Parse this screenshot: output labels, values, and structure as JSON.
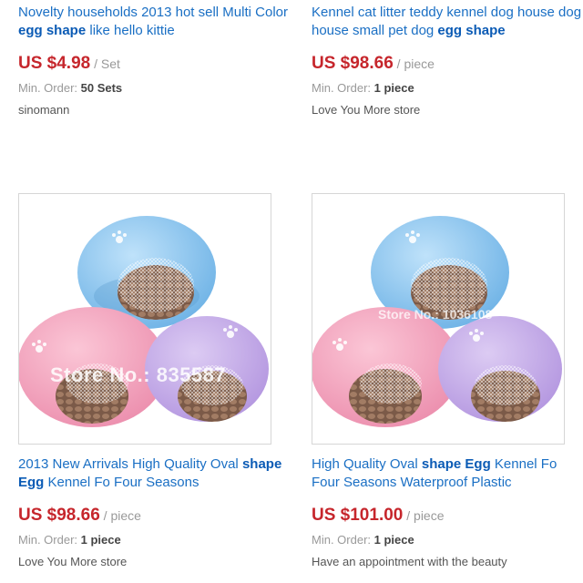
{
  "products": [
    {
      "title_parts": [
        "Novelty households 2013 hot sell Multi Color ",
        "egg shape",
        " like hello kittie"
      ],
      "price": "US $4.98",
      "unit": " / Set",
      "min_order_label": "Min. Order: ",
      "min_order_value": "50 Sets",
      "store": "sinomann"
    },
    {
      "title_parts": [
        "Kennel cat litter teddy kennel dog house dog house small pet dog ",
        "egg shape",
        ""
      ],
      "price": "US $98.66",
      "unit": " / piece",
      "min_order_label": "Min. Order: ",
      "min_order_value": "1 piece",
      "store": "Love You More store"
    },
    {
      "image_watermark": "Store No.: 835587",
      "title_parts": [
        "2013 New Arrivals High Quality Oval ",
        "shape Egg",
        " Kennel Fo Four Seasons"
      ],
      "price": "US $98.66",
      "unit": " / piece",
      "min_order_label": "Min. Order: ",
      "min_order_value": "1 piece",
      "store": "Love You More store"
    },
    {
      "image_watermark": "Store No.: 1036108",
      "title_parts": [
        "High Quality Oval ",
        "shape Egg",
        " Kennel Fo Four Seasons Waterproof Plastic"
      ],
      "price": "US $101.00",
      "unit": " / piece",
      "min_order_label": "Min. Order: ",
      "min_order_value": "1 piece",
      "store": "Have an appointment with the beauty"
    }
  ],
  "colors": {
    "link": "#1a6fc4",
    "price": "#c6262c",
    "kennel_blue": "#7ec0ee",
    "kennel_pink": "#f29bb7",
    "kennel_purple": "#c4a9e8",
    "cushion": "#8a6a58"
  },
  "icons": [
    "paw-print-icon",
    "mesh-door-icon"
  ]
}
